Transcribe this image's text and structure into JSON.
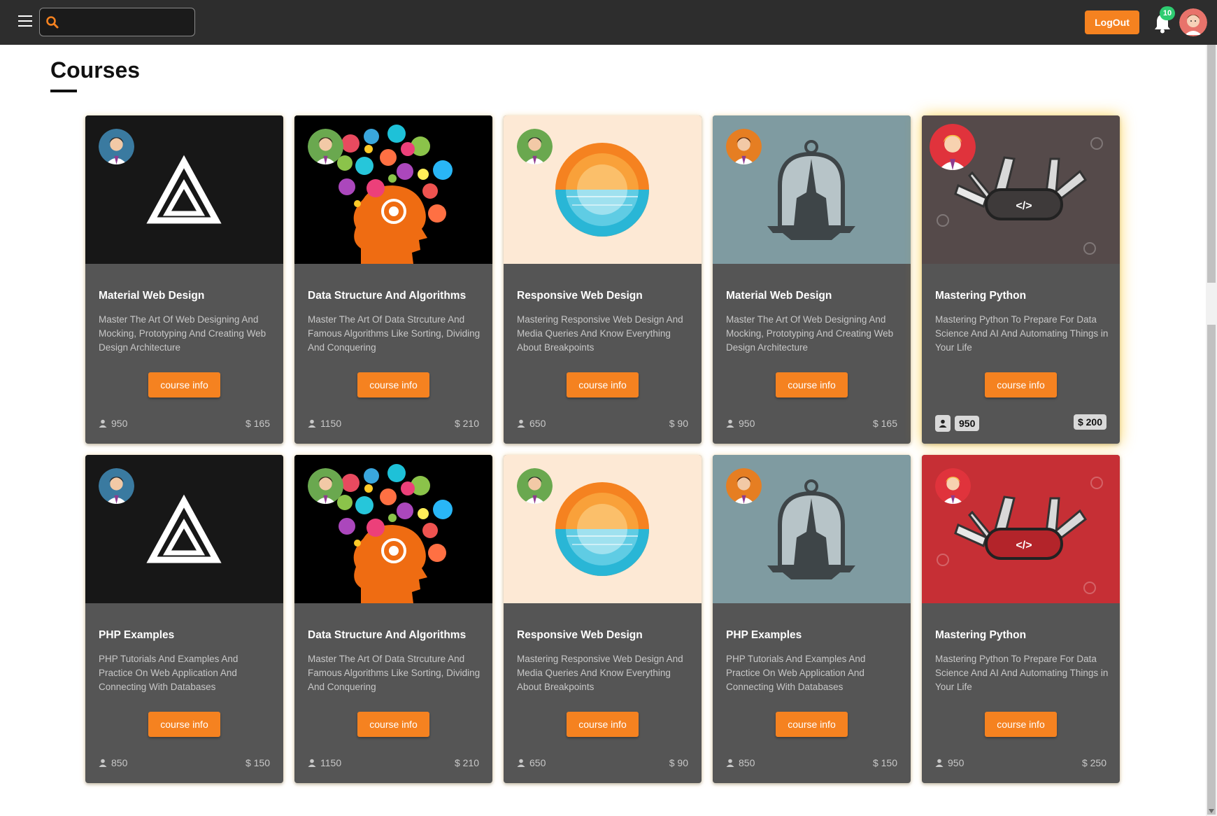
{
  "header": {
    "search_placeholder": "",
    "logout_label": "LogOut",
    "notification_count": "10"
  },
  "page": {
    "title": "Courses"
  },
  "courses": [
    {
      "title": "Material Web Design",
      "desc": "Master The Art Of Web Designing And Mocking, Prototyping And Creating Web Design Architecture",
      "button": "course info",
      "students": "950",
      "price": "$ 165",
      "image": "triangle-logo"
    },
    {
      "title": "Data Structure And Algorithms",
      "desc": "Master The Art Of Data Strcuture And Famous Algorithms Like Sorting, Dividing And Conquering",
      "button": "course info",
      "students": "1150",
      "price": "$ 210",
      "image": "brain-head"
    },
    {
      "title": "Responsive Web Design",
      "desc": "Mastering Responsive Web Design And Media Queries And Know Everything About Breakpoints",
      "button": "course info",
      "students": "650",
      "price": "$ 90",
      "image": "sunset-circle"
    },
    {
      "title": "Material Web Design",
      "desc": "Master The Art Of Web Designing And Mocking, Prototyping And Creating Web Design Architecture",
      "button": "course info",
      "students": "950",
      "price": "$ 165",
      "image": "church-dome"
    },
    {
      "title": "Mastering Python",
      "desc": "Mastering Python To Prepare For Data Science And AI And Automating Things in Your Life",
      "button": "course info",
      "students": "950",
      "price": "$ 200",
      "image": "swiss-knife-dark"
    },
    {
      "title": "PHP Examples",
      "desc": "PHP Tutorials And Examples And Practice On Web Application And Connecting With Databases",
      "button": "course info",
      "students": "850",
      "price": "$ 150",
      "image": "triangle-logo"
    },
    {
      "title": "Data Structure And Algorithms",
      "desc": "Master The Art Of Data Strcuture And Famous Algorithms Like Sorting, Dividing And Conquering",
      "button": "course info",
      "students": "1150",
      "price": "$ 210",
      "image": "brain-head"
    },
    {
      "title": "Responsive Web Design",
      "desc": "Mastering Responsive Web Design And Media Queries And Know Everything About Breakpoints",
      "button": "course info",
      "students": "650",
      "price": "$ 90",
      "image": "sunset-circle"
    },
    {
      "title": "PHP Examples",
      "desc": "PHP Tutorials And Examples And Practice On Web Application And Connecting With Databases",
      "button": "course info",
      "students": "850",
      "price": "$ 150",
      "image": "church-dome"
    },
    {
      "title": "Mastering Python",
      "desc": "Mastering Python To Prepare For Data Science And AI And Automating Things in Your Life",
      "button": "course info",
      "students": "950",
      "price": "$ 250",
      "image": "swiss-knife-red"
    }
  ],
  "colors": {
    "accent": "#f58220",
    "topbar": "#2d2d2d",
    "card": "#555555",
    "badge": "#2ecc71"
  }
}
